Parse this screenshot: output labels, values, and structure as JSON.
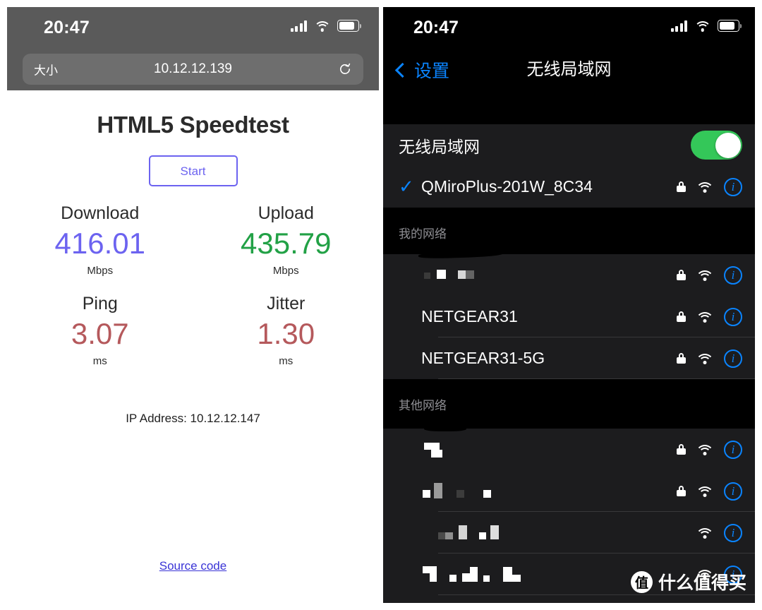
{
  "left_phone": {
    "status_bar": {
      "time": "20:47",
      "signal_icon": "cellular-bars-icon",
      "wifi_icon": "wifi-icon",
      "battery_icon": "battery-icon"
    },
    "browser": {
      "url_left_label": "大小",
      "url": "10.12.12.139",
      "reload_icon": "reload-icon"
    },
    "page": {
      "title": "HTML5 Speedtest",
      "start_button": "Start",
      "metrics": [
        {
          "label": "Download",
          "value": "416.01",
          "unit": "Mbps",
          "color": "#6c63f0"
        },
        {
          "label": "Upload",
          "value": "435.79",
          "unit": "Mbps",
          "color": "#22a146"
        },
        {
          "label": "Ping",
          "value": "3.07",
          "unit": "ms",
          "color": "#b5595c"
        },
        {
          "label": "Jitter",
          "value": "1.30",
          "unit": "ms",
          "color": "#b5595c"
        }
      ],
      "ip_line": "IP Address: 10.12.12.147",
      "source_link": "Source code"
    }
  },
  "right_phone": {
    "status_bar": {
      "time": "20:47",
      "signal_icon": "cellular-bars-icon",
      "wifi_icon": "wifi-icon",
      "battery_icon": "battery-icon"
    },
    "nav": {
      "back_label": "设置",
      "back_icon": "chevron-left-icon",
      "title": "无线局域网"
    },
    "wifi_toggle_row": {
      "label": "无线局域网",
      "enabled": true
    },
    "connected_network": {
      "name": "QMiroPlus-201W_8C34",
      "checked": true,
      "locked": true,
      "check_icon": "checkmark-icon",
      "lock_icon": "lock-icon",
      "wifi_icon": "wifi-icon",
      "info_icon": "info-circle-icon"
    },
    "sections": [
      {
        "header": "我的网络",
        "networks": [
          {
            "name": "",
            "redacted": true,
            "locked": true
          },
          {
            "name": "NETGEAR31",
            "redacted": false,
            "locked": true
          },
          {
            "name": "NETGEAR31-5G",
            "redacted": false,
            "locked": true
          }
        ]
      },
      {
        "header": "其他网络",
        "networks": [
          {
            "name": "",
            "redacted": true,
            "locked": true
          },
          {
            "name": "",
            "redacted": true,
            "locked": true
          },
          {
            "name": "",
            "redacted": true,
            "locked": false
          },
          {
            "name": "",
            "redacted": true,
            "locked": false
          }
        ]
      }
    ],
    "watermark": {
      "badge": "值",
      "text": "什么值得买"
    }
  }
}
